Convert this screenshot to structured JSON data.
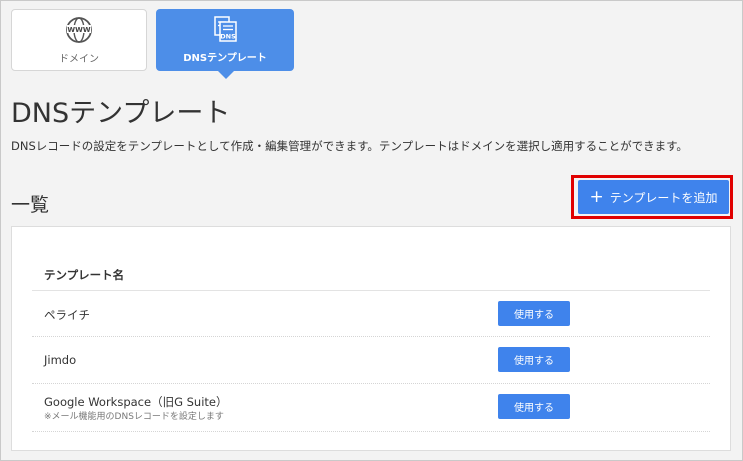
{
  "tabs": [
    {
      "label": "ドメイン",
      "icon": "www-globe-icon",
      "active": false
    },
    {
      "label": "DNSテンプレート",
      "icon": "dns-document-icon",
      "active": true
    }
  ],
  "dns_icon_text": "DNS",
  "www_icon_text": "WWW",
  "page": {
    "title": "DNSテンプレート",
    "description": "DNSレコードの設定をテンプレートとして作成・編集管理ができます。テンプレートはドメインを選択し適用することができます。"
  },
  "section": {
    "title": "一覧",
    "add_button_label": "テンプレートを追加",
    "add_button_plus": "+"
  },
  "table": {
    "column_header": "テンプレート名",
    "rows": [
      {
        "name": "ペライチ",
        "note": "",
        "action_label": "使用する"
      },
      {
        "name": "Jimdo",
        "note": "",
        "action_label": "使用する"
      },
      {
        "name": "Google Workspace（旧G Suite）",
        "note": "※メール機能用のDNSレコードを設定します",
        "action_label": "使用する"
      }
    ]
  },
  "colors": {
    "accent": "#4d8ee8",
    "button": "#3f83ec",
    "highlight": "#e00000",
    "background": "#f3f3f3"
  }
}
